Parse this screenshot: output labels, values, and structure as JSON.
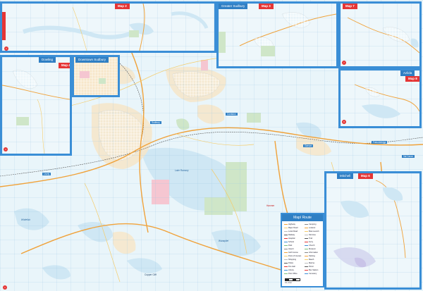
{
  "insets": {
    "map2": {
      "tab_label": "Map 2",
      "badge": "2"
    },
    "valley": {
      "title": "Greater Sudbury",
      "tab_label": "Map 3",
      "badge": "3"
    },
    "map7": {
      "tab_label": "Map 7",
      "badge": "7"
    },
    "dowling": {
      "title": "Dowling",
      "tab_label": "Map 4",
      "badge": "4"
    },
    "chelmsford": {
      "title": "Downtown Sudbury",
      "tab_label": "",
      "badge": ""
    },
    "azilda": {
      "title": "Azilda",
      "tab_label": "Map 8",
      "badge": "8"
    },
    "map6": {
      "title": "Mitchell",
      "tab_label": "Map 6",
      "badge": "6"
    }
  },
  "main_map": {
    "badge": "1",
    "labels": [
      "Sudbury",
      "Coniston",
      "Lively",
      "Garson",
      "Falconbridge",
      "Val Caron",
      "Hanmer",
      "Copper Cliff",
      "Chelmsford",
      "Lake Ramsey",
      "Wanapitei",
      "Whitefish"
    ]
  },
  "legend": {
    "title": "Map/ Route",
    "items": [
      "Highway",
      "Major Road",
      "Local Road",
      "Railway",
      "Hospital",
      "School",
      "Park",
      "Airport",
      "Golf Course",
      "Point of Interest",
      "Shopping",
      "Police",
      "Fire Hall",
      "Library",
      "Post Office",
      "Camping",
      "Lookout",
      "Boat Launch",
      "Ski Area",
      "Trail",
      "Ferry",
      "Church",
      "Museum",
      "Information",
      "Parking",
      "Beach",
      "Marina",
      "Picnic",
      "Bus Station",
      "Cemetery"
    ],
    "scale": "0 1 2 km"
  },
  "colors": {
    "frame": "#3a8ed6",
    "tab": "#2f7fc4",
    "accent": "#e53535",
    "water": "#cfe7f4",
    "land": "#eef7fb",
    "urban_tan": "#f7e6c9",
    "park": "#cfe6c8",
    "road_major": "#f0a23a"
  }
}
